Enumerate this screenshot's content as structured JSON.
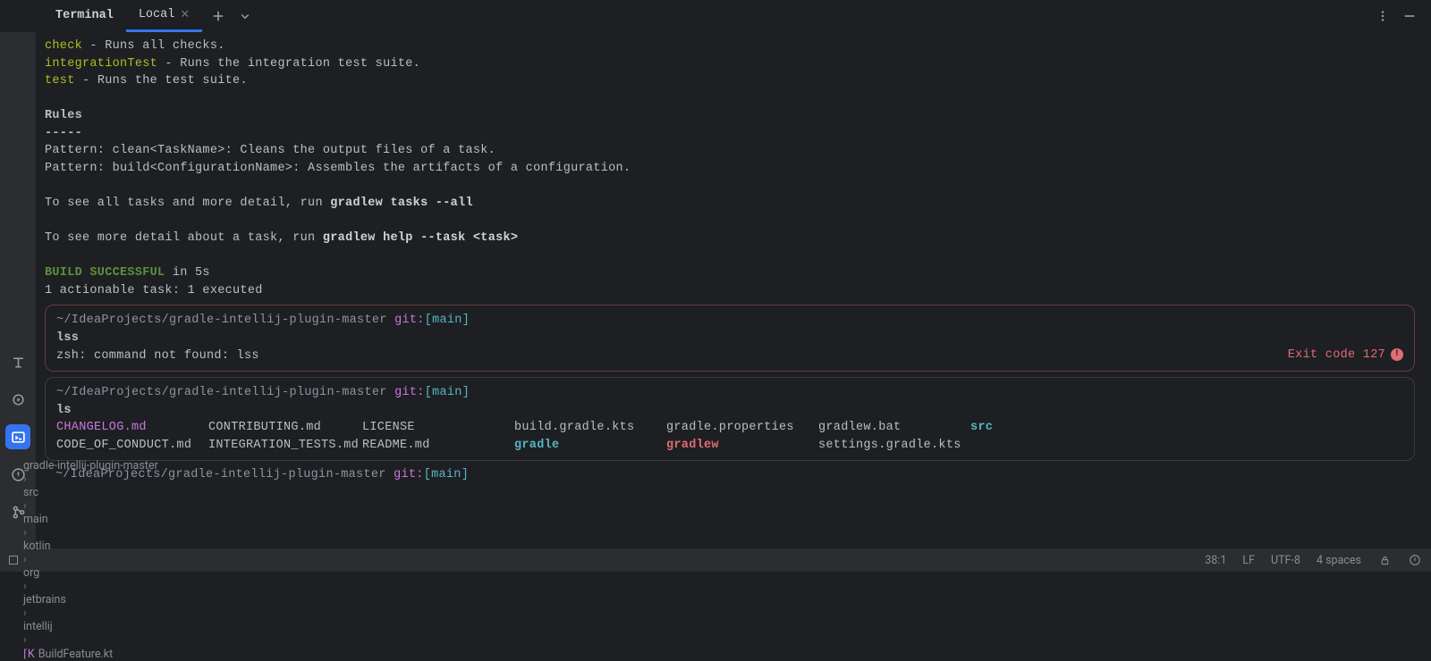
{
  "tabbar": {
    "title": "Terminal",
    "active_tab": "Local"
  },
  "left_stripe": {
    "items": [
      "typography",
      "run",
      "terminal",
      "problems",
      "git"
    ],
    "selected_index": 2
  },
  "term": {
    "tasks": [
      {
        "name": "check",
        "desc": " - Runs all checks."
      },
      {
        "name": "integrationTest",
        "desc": " - Runs the integration test suite."
      },
      {
        "name": "test",
        "desc": " - Runs the test suite."
      }
    ],
    "rules_heading": "Rules",
    "rules_dash": "-----",
    "rules": [
      "Pattern: clean<TaskName>: Cleans the output files of a task.",
      "Pattern: build<ConfigurationName>: Assembles the artifacts of a configuration."
    ],
    "hint1_pre": "To see all tasks and more detail, run ",
    "hint1_bold": "gradlew tasks --all",
    "hint2_pre": "To see more detail about a task, run ",
    "hint2_bold": "gradlew help --task <task>",
    "build_ok": "BUILD SUCCESSFUL",
    "build_time": " in 5s",
    "build_sub": "1 actionable task: 1 executed",
    "prompt_path": "~/IdeaProjects/gradle-intellij-plugin-master",
    "prompt_git": "git:",
    "prompt_branch": "[main]",
    "err_cmd": "lss",
    "err_out": "zsh: command not found: lss",
    "err_exit": "Exit code 127",
    "ok_cmd": "ls",
    "ls_row1": [
      "CHANGELOG.md",
      "CONTRIBUTING.md",
      "LICENSE",
      "build.gradle.kts",
      "gradle.properties",
      "gradlew.bat",
      "src"
    ],
    "ls_row2": [
      "CODE_OF_CONDUCT.md",
      "INTEGRATION_TESTS.md",
      "README.md",
      "gradle",
      "gradlew",
      "settings.gradle.kts",
      ""
    ],
    "ls_class1": [
      "f-md",
      "",
      "",
      "",
      "",
      "",
      "f-src"
    ],
    "ls_class2": [
      "",
      "",
      "",
      "f-teal",
      "f-red",
      "",
      ""
    ]
  },
  "breadcrumbs": {
    "items": [
      "gradle-intellij-plugin-master",
      "src",
      "main",
      "kotlin",
      "org",
      "jetbrains",
      "intellij",
      "BuildFeature.kt"
    ]
  },
  "status": {
    "pos": "38:1",
    "line_sep": "LF",
    "encoding": "UTF-8",
    "indent": "4 spaces"
  }
}
